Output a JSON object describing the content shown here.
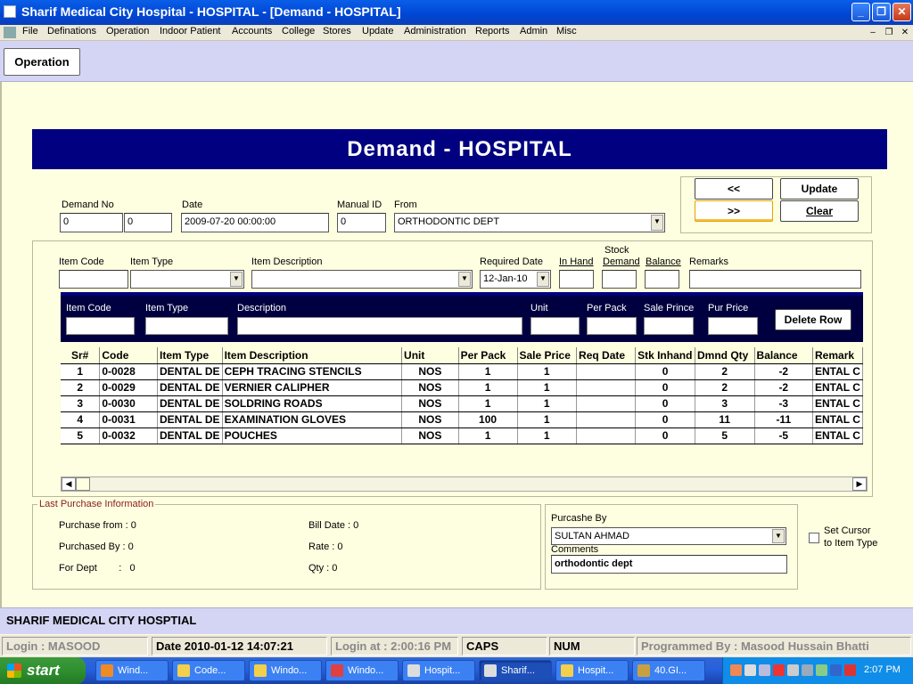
{
  "window": {
    "title": "Sharif Medical City Hospital - HOSPITAL - [Demand - HOSPITAL]"
  },
  "menu": [
    "File",
    "Definations",
    "Operation",
    "Indoor Patient",
    "Accounts",
    "College",
    "Stores",
    "Update",
    "Administration",
    "Reports",
    "Admin",
    "Misc"
  ],
  "toolbar": {
    "operation_label": "Operation"
  },
  "form": {
    "header": "Demand - HOSPITAL",
    "demand_no_label": "Demand No",
    "demand_no_1": "0",
    "demand_no_2": "0",
    "date_label": "Date",
    "date_value": "2009-07-20 00:00:00",
    "manual_id_label": "Manual ID",
    "manual_id_value": "0",
    "from_label": "From",
    "from_value": "ORTHODONTIC DEPT",
    "prev_label": "<<",
    "next_label": ">>",
    "update_label": "Update",
    "clear_label": "Clear"
  },
  "item_entry": {
    "item_code_label": "Item Code",
    "item_type_label": "Item Type",
    "item_desc_label": "Item Description",
    "req_date_label": "Required Date",
    "req_date_value": "12-Jan-10",
    "stock_label": "Stock",
    "in_hand_label": "In Hand",
    "demand_label": "Demand",
    "balance_label": "Balance",
    "remarks_label": "Remarks"
  },
  "edit_row": {
    "item_code_label": "Item Code",
    "item_type_label": "Item Type",
    "description_label": "Description",
    "unit_label": "Unit",
    "per_pack_label": "Per Pack",
    "sale_price_label": "Sale Prince",
    "pur_price_label": "Pur Price",
    "delete_row_label": "Delete Row"
  },
  "grid": {
    "columns": [
      "Sr#",
      "Code",
      "Item Type",
      "Item Description",
      "Unit",
      "Per Pack",
      "Sale Price",
      "Req Date",
      "Stk Inhand",
      "Dmnd Qty",
      "Balance",
      "Remark"
    ],
    "rows": [
      [
        "1",
        "0-0028",
        "DENTAL DE",
        "CEPH TRACING STENCILS",
        "NOS",
        "1",
        "1",
        "",
        "0",
        "2",
        "-2",
        "ENTAL C"
      ],
      [
        "2",
        "0-0029",
        "DENTAL DE",
        "VERNIER CALIPHER",
        "NOS",
        "1",
        "1",
        "",
        "0",
        "2",
        "-2",
        "ENTAL C"
      ],
      [
        "3",
        "0-0030",
        "DENTAL DE",
        "SOLDRING ROADS",
        "NOS",
        "1",
        "1",
        "",
        "0",
        "3",
        "-3",
        "ENTAL C"
      ],
      [
        "4",
        "0-0031",
        "DENTAL DE",
        "EXAMINATION GLOVES",
        "NOS",
        "100",
        "1",
        "",
        "0",
        "11",
        "-11",
        "ENTAL C"
      ],
      [
        "5",
        "0-0032",
        "DENTAL DE",
        "POUCHES",
        "NOS",
        "1",
        "1",
        "",
        "0",
        "5",
        "-5",
        "ENTAL C"
      ]
    ]
  },
  "last_purchase": {
    "title": "Last Purchase Information",
    "purchase_from": "Purchase from : 0",
    "purchased_by": "Purchased By :  0",
    "for_dept": "For Dept        :   0",
    "bill_date": "Bill Date :  0",
    "rate": "Rate :  0",
    "qty": "Qty :  0"
  },
  "purchase_by": {
    "label": "Purcashe By",
    "value": "SULTAN AHMAD",
    "comments_label": "Comments",
    "comments_value": "orthodontic dept"
  },
  "set_cursor_label_1": "Set Cursor",
  "set_cursor_label_2": "to Item Type",
  "org_name": "SHARIF MEDICAL CITY HOSPTIAL",
  "status": {
    "login": "Login :  MASOOD",
    "date": "Date 2010-01-12 14:07:21",
    "login_at": "Login at : 2:00:16 PM",
    "caps": "CAPS",
    "num": "NUM",
    "programmer": "Programmed By : Masood Hussain Bhatti"
  },
  "taskbar": {
    "start_label": "start",
    "items": [
      "Wind...",
      "Code...",
      "Windo...",
      "Windo...",
      "Hospit...",
      "Sharif...",
      "Hospit...",
      "40.GI..."
    ],
    "clock": "2:07 PM"
  }
}
